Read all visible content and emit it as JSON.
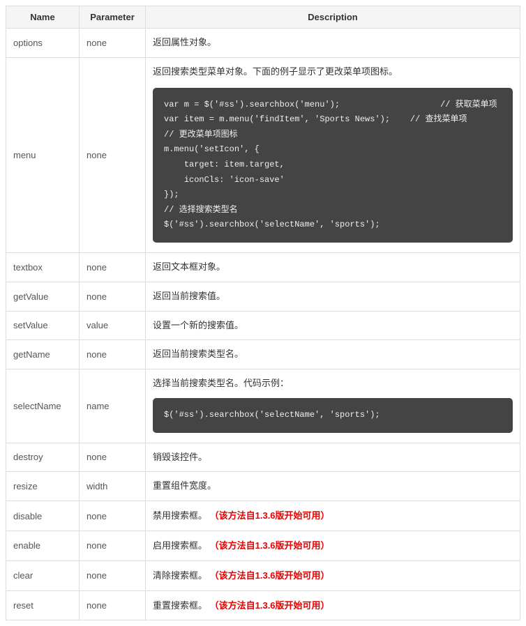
{
  "table": {
    "headers": {
      "name": "Name",
      "parameter": "Parameter",
      "description": "Description"
    },
    "rows": [
      {
        "name": "options",
        "parameter": "none",
        "description": "返回属性对象。",
        "versionNote": "",
        "code": ""
      },
      {
        "name": "menu",
        "parameter": "none",
        "description": "返回搜索类型菜单对象。下面的例子显示了更改菜单项图标。",
        "versionNote": "",
        "code": "var m = $('#ss').searchbox('menu');                    // 获取菜单项\nvar item = m.menu('findItem', 'Sports News');    // 查找菜单项\n// 更改菜单项图标\nm.menu('setIcon', {\n    target: item.target,\n    iconCls: 'icon-save'\n});\n// 选择搜索类型名\n$('#ss').searchbox('selectName', 'sports');"
      },
      {
        "name": "textbox",
        "parameter": "none",
        "description": "返回文本框对象。",
        "versionNote": "",
        "code": ""
      },
      {
        "name": "getValue",
        "parameter": "none",
        "description": "返回当前搜索值。",
        "versionNote": "",
        "code": ""
      },
      {
        "name": "setValue",
        "parameter": "value",
        "description": "设置一个新的搜索值。",
        "versionNote": "",
        "code": ""
      },
      {
        "name": "getName",
        "parameter": "none",
        "description": "返回当前搜索类型名。",
        "versionNote": "",
        "code": ""
      },
      {
        "name": "selectName",
        "parameter": "name",
        "description": "选择当前搜索类型名。代码示例：",
        "versionNote": "",
        "code": "$('#ss').searchbox('selectName', 'sports');"
      },
      {
        "name": "destroy",
        "parameter": "none",
        "description": "销毁该控件。",
        "versionNote": "",
        "code": ""
      },
      {
        "name": "resize",
        "parameter": "width",
        "description": "重置组件宽度。",
        "versionNote": "",
        "code": ""
      },
      {
        "name": "disable",
        "parameter": "none",
        "description": "禁用搜索框。",
        "versionNote": "（该方法自1.3.6版开始可用）",
        "code": ""
      },
      {
        "name": "enable",
        "parameter": "none",
        "description": "启用搜索框。",
        "versionNote": "（该方法自1.3.6版开始可用）",
        "code": ""
      },
      {
        "name": "clear",
        "parameter": "none",
        "description": "清除搜索框。",
        "versionNote": "（该方法自1.3.6版开始可用）",
        "code": ""
      },
      {
        "name": "reset",
        "parameter": "none",
        "description": "重置搜索框。",
        "versionNote": "（该方法自1.3.6版开始可用）",
        "code": ""
      }
    ]
  }
}
